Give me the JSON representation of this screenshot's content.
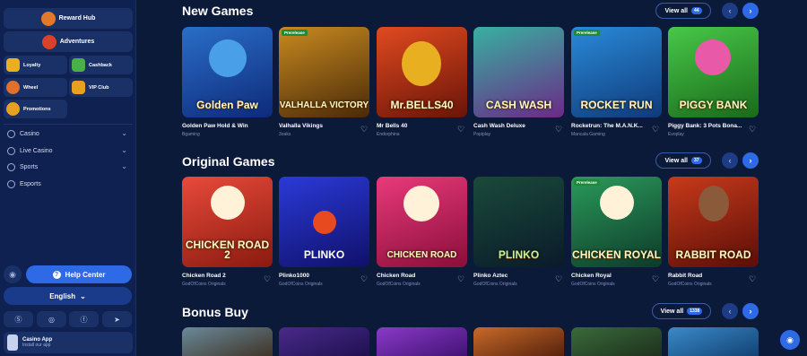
{
  "sidebar": {
    "reward_hub": "Reward Hub",
    "adventures": "Adventures",
    "tiles": {
      "loyalty": "Loyalty",
      "cashback": "Cashback",
      "wheel": "Wheel",
      "vip": "VIP Club",
      "promotions": "Promotions"
    },
    "nav": {
      "casino": "Casino",
      "live_casino": "Live Casino",
      "sports": "Sports",
      "esports": "Esports"
    },
    "help": "Help Center",
    "language": "English",
    "app_title": "Casino App",
    "app_subtitle": "Install our app"
  },
  "sections": {
    "new_games": {
      "title": "New Games",
      "view_all": "View all",
      "count": "44",
      "games": [
        {
          "name": "Golden Paw Hold & Win",
          "provider": "Bgaming",
          "art": "Golden Paw"
        },
        {
          "name": "Valhalla Vikings",
          "provider": "3oaks",
          "art": "VALHALLA VICTORY"
        },
        {
          "name": "Mr Bells 40",
          "provider": "Endorphina",
          "art": "Mr.BELLS40"
        },
        {
          "name": "Cash Wash Deluxe",
          "provider": "Popiplay",
          "art": "CASH WASH"
        },
        {
          "name": "Rocketrun: The M.A.N.K...",
          "provider": "Mancala Gaming",
          "art": "ROCKET RUN"
        },
        {
          "name": "Piggy Bank: 3 Pots Bona...",
          "provider": "Evoplay",
          "art": "PIGGY BANK"
        }
      ]
    },
    "original_games": {
      "title": "Original Games",
      "view_all": "View all",
      "count": "37",
      "games": [
        {
          "name": "Chicken Road 2",
          "provider": "GodOfCoins Originals",
          "art": "CHICKEN ROAD 2"
        },
        {
          "name": "Plinko1000",
          "provider": "GodOfCoins Originals",
          "art": "PLINKO"
        },
        {
          "name": "Chicken Road",
          "provider": "GodOfCoins Originals",
          "art": "CHICKEN ROAD"
        },
        {
          "name": "Plinko Aztec",
          "provider": "GodOfCoins Originals",
          "art": "PLINKO"
        },
        {
          "name": "Chicken Royal",
          "provider": "GodOfCoins Originals",
          "art": "CHICKEN ROYAL"
        },
        {
          "name": "Rabbit Road",
          "provider": "GodOfCoins Originals",
          "art": "RABBIT ROAD"
        }
      ]
    },
    "bonus_buy": {
      "title": "Bonus Buy",
      "view_all": "View all",
      "count": "1338"
    }
  },
  "badges": {
    "prerelease": "Prerelease"
  },
  "icons": {
    "heart": "heart-icon",
    "prev": "chevron-left-icon",
    "next": "chevron-right-icon",
    "chevron": "chevron-down-icon"
  },
  "colors": {
    "background": "#0c1a3a",
    "sidebar": "#0f2150",
    "accent": "#2f6ae6"
  }
}
